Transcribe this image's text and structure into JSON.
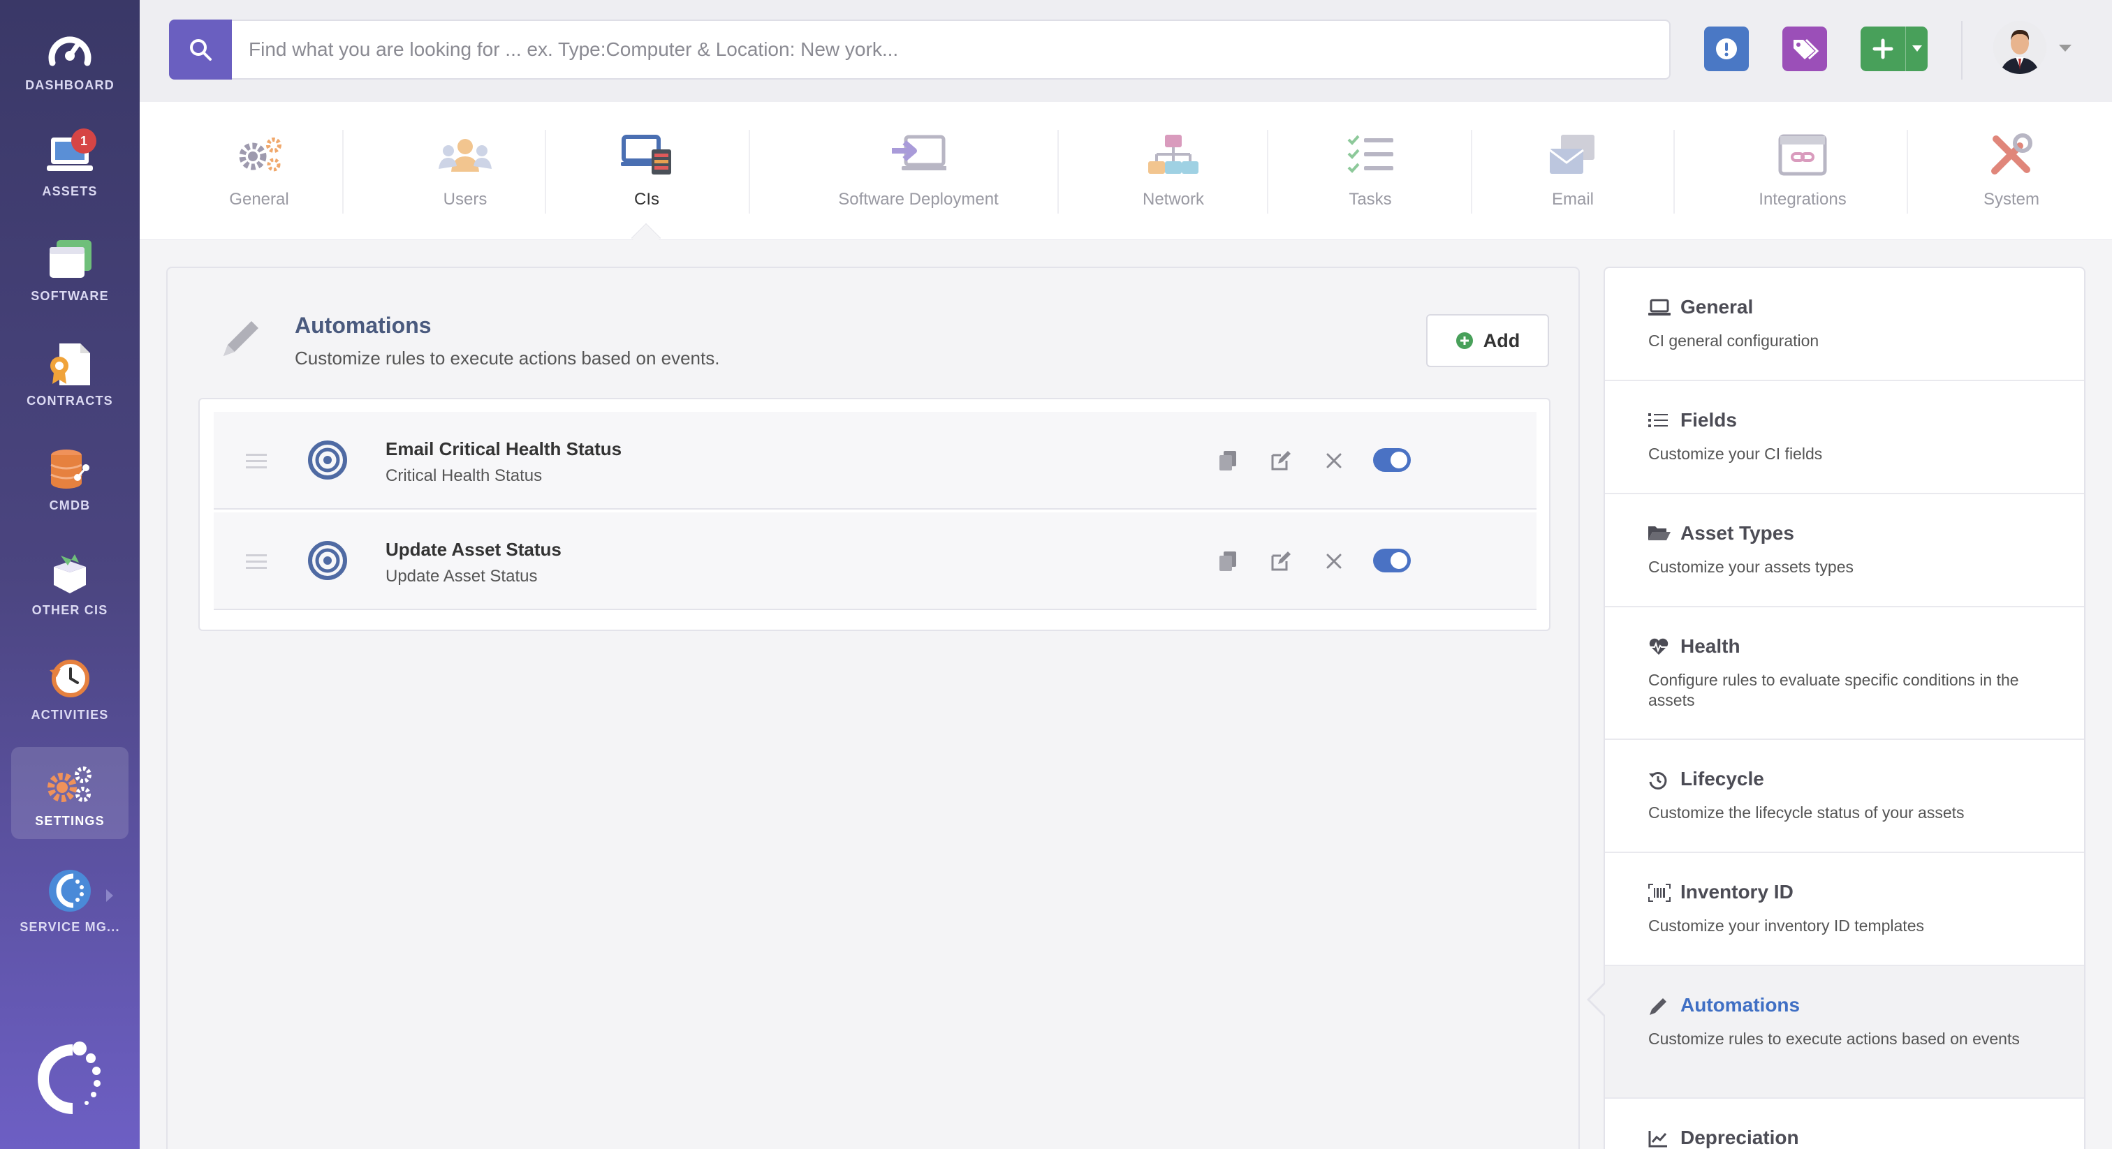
{
  "sidebar": {
    "items": [
      {
        "label": "DASHBOARD",
        "icon": "dashboard-gauge-icon"
      },
      {
        "label": "ASSETS",
        "icon": "laptop-icon",
        "badge": "1"
      },
      {
        "label": "SOFTWARE",
        "icon": "software-window-icon"
      },
      {
        "label": "CONTRACTS",
        "icon": "contract-document-icon"
      },
      {
        "label": "CMDB",
        "icon": "database-icon"
      },
      {
        "label": "OTHER CIS",
        "icon": "box-icon"
      },
      {
        "label": "ACTIVITIES",
        "icon": "history-clock-icon"
      },
      {
        "label": "SETTINGS",
        "icon": "gears-icon",
        "active": true
      },
      {
        "label": "SERVICE MG...",
        "icon": "service-management-icon"
      }
    ],
    "brand_icon": "brand-logo-icon"
  },
  "topbar": {
    "search_placeholder": "Find what you are looking for ... ex. Type:Computer & Location: New york...",
    "search_value": "",
    "colors": {
      "search": "#6a5fc0",
      "alert": "#4a78c5",
      "tags": "#9b4fb8",
      "add": "#48a05a"
    }
  },
  "tabs": [
    {
      "label": "General",
      "icon": "gears-icon"
    },
    {
      "label": "Users",
      "icon": "users-icon"
    },
    {
      "label": "CIs",
      "icon": "cis-icon",
      "active": true
    },
    {
      "label": "Software Deployment",
      "icon": "deployment-icon"
    },
    {
      "label": "Network",
      "icon": "network-icon"
    },
    {
      "label": "Tasks",
      "icon": "tasks-icon"
    },
    {
      "label": "Email",
      "icon": "email-icon"
    },
    {
      "label": "Integrations",
      "icon": "integrations-icon"
    },
    {
      "label": "System",
      "icon": "system-tools-icon"
    }
  ],
  "main": {
    "title": "Automations",
    "subtitle": "Customize rules to execute actions based on events.",
    "add_label": "Add",
    "rules": [
      {
        "title": "Email Critical Health Status",
        "subtitle": "Critical Health Status",
        "enabled": true
      },
      {
        "title": "Update Asset Status",
        "subtitle": "Update Asset Status",
        "enabled": true
      }
    ]
  },
  "side_panel": {
    "items": [
      {
        "title": "General",
        "desc": "CI general configuration",
        "icon": "laptop-outline-icon"
      },
      {
        "title": "Fields",
        "desc": "Customize your CI fields",
        "icon": "list-icon"
      },
      {
        "title": "Asset Types",
        "desc": "Customize your assets types",
        "icon": "folder-open-icon"
      },
      {
        "title": "Health",
        "desc": "Configure rules to evaluate specific conditions in the assets",
        "icon": "heartbeat-icon"
      },
      {
        "title": "Lifecycle",
        "desc": "Customize the lifecycle status of your assets",
        "icon": "history-icon"
      },
      {
        "title": "Inventory ID",
        "desc": "Customize your inventory ID templates",
        "icon": "barcode-icon"
      },
      {
        "title": "Automations",
        "desc": "Customize rules to execute actions based on events",
        "icon": "pencil-icon",
        "active": true
      },
      {
        "title": "Depreciation",
        "desc": "",
        "icon": "chart-line-icon"
      }
    ]
  }
}
